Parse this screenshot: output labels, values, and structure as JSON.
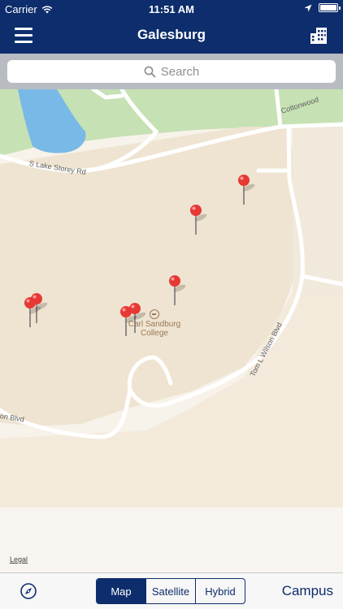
{
  "status_bar": {
    "carrier": "Carrier",
    "time": "11:51 AM",
    "battery_level": 1.0
  },
  "nav_bar": {
    "title": "Galesburg",
    "left_icon": "hamburger-menu-icon",
    "right_icon": "building-icon"
  },
  "search": {
    "placeholder": "Search"
  },
  "map": {
    "road_labels": {
      "lake_storey": "S Lake Storey Rd",
      "cottonwood": "Cottonwood",
      "tom_wilson": "Tom L Wilson Blvd",
      "wilson_blvd_left": "on Blvd"
    },
    "poi": {
      "name_line1": "Carl Sandburg",
      "name_line2": "College"
    },
    "pin_count": 7,
    "legal_label": "Legal",
    "colors": {
      "land": "#f7f2ea",
      "water": "#79b9e8",
      "park": "#c6e1b4",
      "campus": "#efe4d1",
      "pin": "#e53935"
    }
  },
  "bottom_bar": {
    "compass_icon": "compass-icon",
    "map_types": [
      "Map",
      "Satellite",
      "Hybrid"
    ],
    "selected_map_type": "Map",
    "campus_label": "Campus"
  },
  "colors": {
    "brand": "#0d2d6c"
  }
}
